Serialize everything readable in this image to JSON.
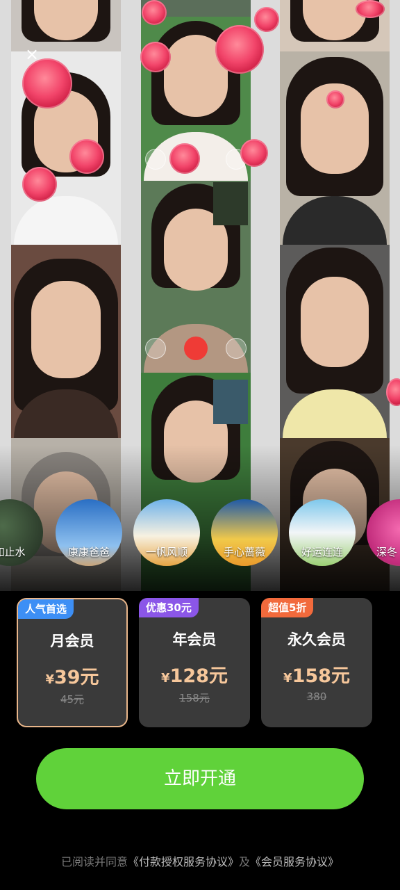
{
  "close_glyph": "×",
  "avatars": [
    {
      "label": "如止水"
    },
    {
      "label": "康康爸爸"
    },
    {
      "label": "一帆风顺"
    },
    {
      "label": "手心蔷薇"
    },
    {
      "label": "好运连连"
    },
    {
      "label": "深冬"
    }
  ],
  "plans": [
    {
      "badge": "人气首选",
      "badge_color": "#3d8ff5",
      "name": "月会员",
      "currency": "¥",
      "price": "39元",
      "original": "45元",
      "selected": true
    },
    {
      "badge": "优惠30元",
      "badge_color": "#8b56e8",
      "name": "年会员",
      "currency": "¥",
      "price": "128元",
      "original": "158元",
      "selected": false
    },
    {
      "badge": "超值5折",
      "badge_color": "#f26a3c",
      "name": "永久会员",
      "currency": "¥",
      "price": "158元",
      "original": "380",
      "selected": false
    }
  ],
  "cta_label": "立即开通",
  "agreement": {
    "prefix": "已阅读并同意",
    "link1": "《付款授权服务协议》",
    "middle": "及",
    "link2": "《会员服务协议》"
  },
  "colors": {
    "accent": "#60d23a",
    "price": "#f6c79b",
    "selected_border": "#e9b68a"
  }
}
